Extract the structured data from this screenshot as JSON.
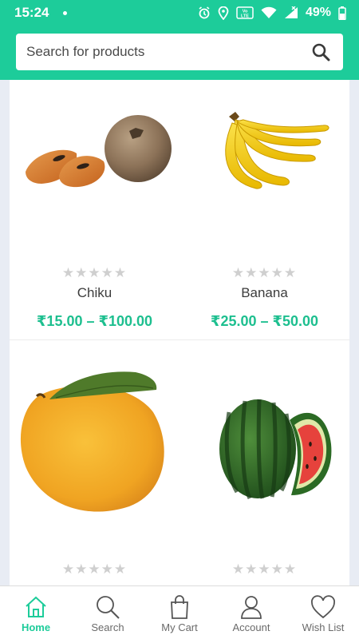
{
  "status_bar": {
    "time": "15:24",
    "battery": "49%",
    "volte": "Vo LTE"
  },
  "search": {
    "placeholder": "Search for products"
  },
  "products": [
    {
      "name": "Chiku",
      "price": "₹15.00 – ₹100.00",
      "rating": 0,
      "stars": "★★★★★"
    },
    {
      "name": "Banana",
      "price": "₹25.00 – ₹50.00",
      "rating": 0,
      "stars": "★★★★★"
    },
    {
      "name": "",
      "price": "",
      "rating": 0,
      "stars": "★★★★★"
    },
    {
      "name": "",
      "price": "",
      "rating": 0,
      "stars": "★★★★★"
    }
  ],
  "nav": {
    "home": "Home",
    "search": "Search",
    "cart": "My Cart",
    "account": "Account",
    "wishlist": "Wish List"
  },
  "colors": {
    "accent": "#1dcc9a",
    "price": "#1dbf8f",
    "star_empty": "#cfcfcf"
  }
}
